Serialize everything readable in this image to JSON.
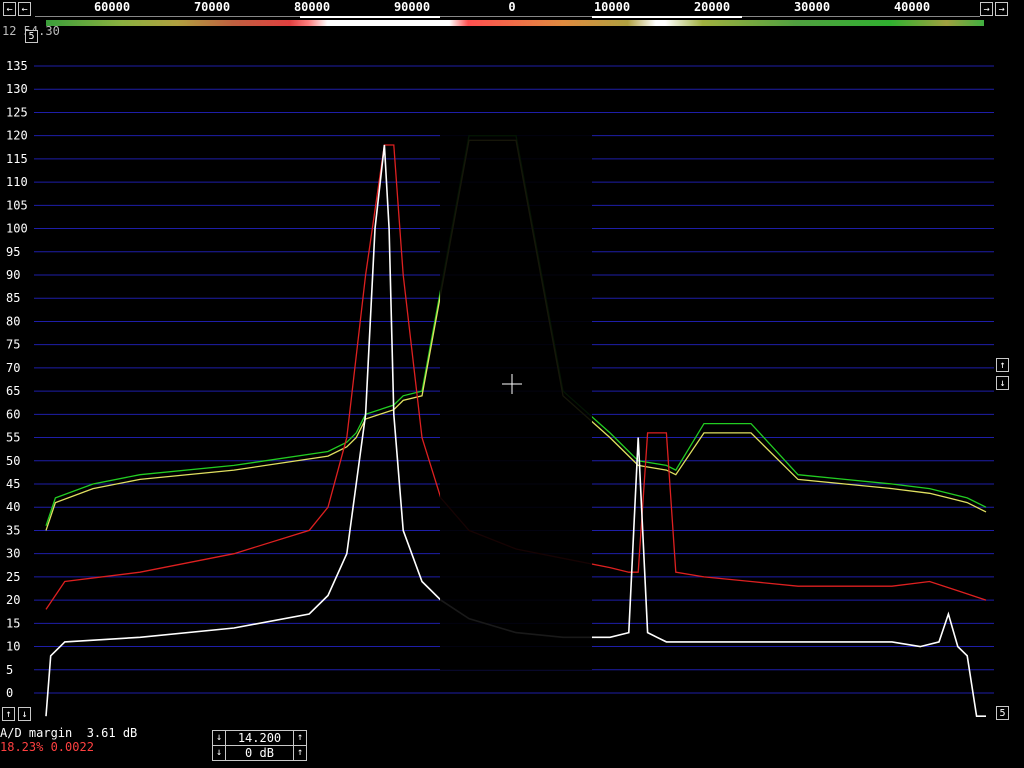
{
  "top_axis": {
    "ticks": [
      "60000",
      "70000",
      "80000",
      "90000",
      "0",
      "10000",
      "20000",
      "30000",
      "40000"
    ],
    "buttons": {
      "left_arrow": "←",
      "right_arrow": "→"
    }
  },
  "header_text": "12 54.30",
  "header_box": "5",
  "chart_data": {
    "type": "line",
    "ylim": [
      -5,
      140
    ],
    "y_ticks": [
      135,
      130,
      125,
      120,
      115,
      110,
      105,
      100,
      95,
      90,
      85,
      80,
      75,
      70,
      65,
      60,
      55,
      50,
      45,
      40,
      35,
      30,
      25,
      20,
      15,
      10,
      5,
      0
    ],
    "x_relative_range": [
      0,
      1
    ],
    "series": [
      {
        "color": "#22cc22",
        "x": [
          0.0,
          0.01,
          0.05,
          0.1,
          0.2,
          0.3,
          0.32,
          0.33,
          0.34,
          0.37,
          0.38,
          0.4,
          0.45,
          0.5,
          0.55,
          0.6,
          0.62,
          0.63,
          0.66,
          0.67,
          0.7,
          0.75,
          0.8,
          0.85,
          0.9,
          0.94,
          0.96,
          0.98,
          1.0
        ],
        "y": [
          36,
          42,
          45,
          47,
          49,
          52,
          54,
          56,
          60,
          62,
          64,
          65,
          120,
          120,
          65,
          56,
          52,
          50,
          49,
          48,
          58,
          58,
          47,
          46,
          45,
          44,
          43,
          42,
          40
        ]
      },
      {
        "color": "#e0e060",
        "x": [
          0.0,
          0.01,
          0.05,
          0.1,
          0.2,
          0.3,
          0.32,
          0.33,
          0.34,
          0.37,
          0.38,
          0.4,
          0.45,
          0.5,
          0.55,
          0.6,
          0.62,
          0.63,
          0.66,
          0.67,
          0.7,
          0.75,
          0.8,
          0.85,
          0.9,
          0.94,
          0.96,
          0.98,
          1.0
        ],
        "y": [
          35,
          41,
          44,
          46,
          48,
          51,
          53,
          55,
          59,
          61,
          63,
          64,
          119,
          119,
          64,
          55,
          51,
          49,
          48,
          47,
          56,
          56,
          46,
          45,
          44,
          43,
          42,
          41,
          39
        ]
      },
      {
        "color": "#dd2020",
        "x": [
          0.0,
          0.02,
          0.1,
          0.2,
          0.28,
          0.3,
          0.32,
          0.34,
          0.36,
          0.37,
          0.38,
          0.4,
          0.42,
          0.45,
          0.5,
          0.55,
          0.6,
          0.62,
          0.63,
          0.64,
          0.66,
          0.67,
          0.7,
          0.75,
          0.8,
          0.85,
          0.9,
          0.94,
          0.97,
          1.0
        ],
        "y": [
          18,
          24,
          26,
          30,
          35,
          40,
          55,
          90,
          118,
          118,
          90,
          55,
          42,
          35,
          31,
          29,
          27,
          26,
          26,
          56,
          56,
          26,
          25,
          24,
          23,
          23,
          23,
          24,
          22,
          20
        ]
      },
      {
        "color": "#ffffff",
        "x": [
          0.0,
          0.005,
          0.02,
          0.1,
          0.2,
          0.28,
          0.3,
          0.32,
          0.34,
          0.35,
          0.36,
          0.365,
          0.37,
          0.38,
          0.4,
          0.42,
          0.45,
          0.5,
          0.55,
          0.6,
          0.62,
          0.63,
          0.64,
          0.65,
          0.66,
          0.7,
          0.8,
          0.9,
          0.93,
          0.95,
          0.96,
          0.97,
          0.98,
          0.99,
          1.0
        ],
        "y": [
          -5,
          8,
          11,
          12,
          14,
          17,
          21,
          30,
          60,
          100,
          118,
          100,
          60,
          35,
          24,
          20,
          16,
          13,
          12,
          12,
          13,
          55,
          13,
          12,
          11,
          11,
          11,
          11,
          10,
          11,
          17,
          10,
          8,
          -5,
          -5
        ]
      }
    ]
  },
  "cursor_symbol": "+",
  "right_buttons": {
    "up": "↑",
    "down": "↓",
    "five": "5"
  },
  "left_bottom_buttons": {
    "up": "↑",
    "down": "↓"
  },
  "status": {
    "ad_label": "A/D margin",
    "ad_value": "3.61 dB",
    "pct_text": "18.23% 0.0022"
  },
  "controls": [
    {
      "up": "↑",
      "down": "↓",
      "value": "14.200"
    },
    {
      "up": "↑",
      "down": "↓",
      "value": "0 dB"
    }
  ]
}
